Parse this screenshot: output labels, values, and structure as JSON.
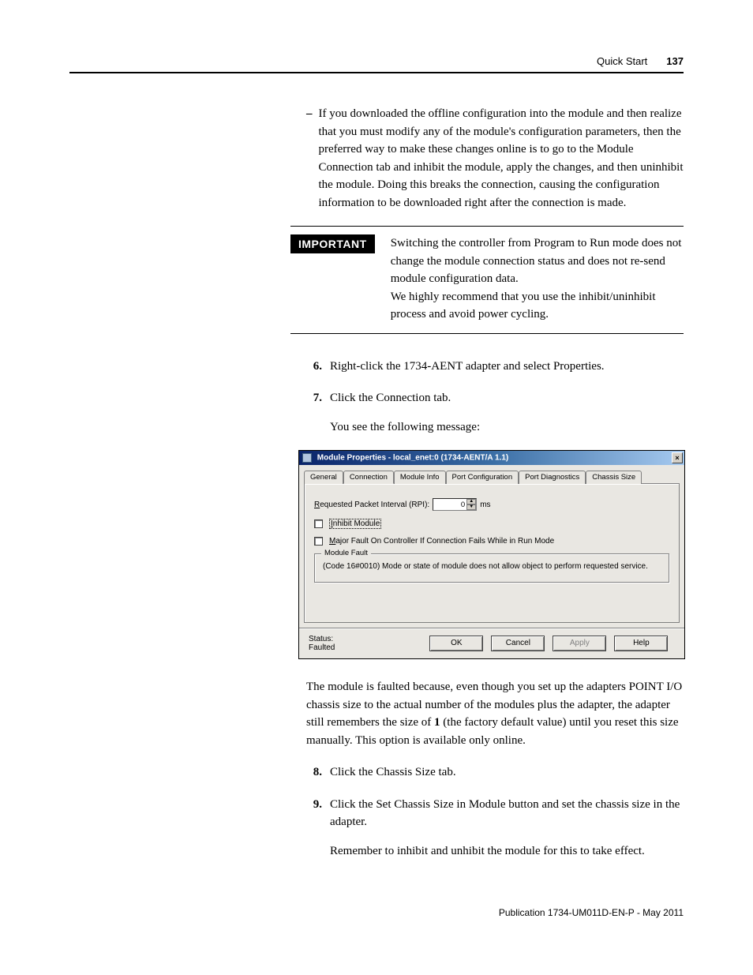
{
  "header": {
    "section": "Quick Start",
    "page": "137"
  },
  "body": {
    "bullet_text": "If you downloaded the offline configuration into the module and then realize that you must modify any of the module's configuration parameters, then the preferred way to make these changes online is to go to the Module Connection tab and inhibit the module, apply the changes, and then uninhibit the module. Doing this breaks the connection, causing the configuration information to be downloaded right after the connection is made.",
    "important_label": "IMPORTANT",
    "important_p1": "Switching the controller from Program to Run mode does not change the module connection status and does not re-send module configuration data.",
    "important_p2": "We highly recommend that you use the inhibit/uninhibit process and avoid power cycling.",
    "steps": {
      "s6_num": "6.",
      "s6": "Right-click the 1734-AENT adapter and select Properties.",
      "s7_num": "7.",
      "s7": "Click the Connection tab.",
      "s7_after": "You see the following message:",
      "after_dialog": "The module is faulted because, even though you set up the adapters POINT I/O chassis size to the actual number of the modules plus the adapter, the adapter still remembers the size of ",
      "after_dialog_bold": "1",
      "after_dialog2": " (the factory default value) until you reset this size manually. This option is available only online.",
      "s8_num": "8.",
      "s8": "Click the Chassis Size tab.",
      "s9_num": "9.",
      "s9": "Click the Set Chassis Size in Module button and set the chassis size in the adapter.",
      "s9_after": "Remember to inhibit and unhibit the module for this to take effect."
    }
  },
  "dialog": {
    "title": "Module Properties - local_enet:0 (1734-AENT/A 1.1)",
    "close": "×",
    "tabs": {
      "general": "General",
      "connection": "Connection",
      "module_info": "Module Info",
      "port_config": "Port Configuration",
      "port_diag": "Port Diagnostics",
      "chassis": "Chassis Size"
    },
    "rpi_label_pre": "R",
    "rpi_label_rest": "equested Packet Interval (RPI):",
    "rpi_value": "0",
    "rpi_unit": "ms",
    "inhibit_pre": "I",
    "inhibit_rest": "nhibit Module",
    "major_pre": "M",
    "major_rest": "ajor Fault On Controller If Connection Fails While in Run Mode",
    "fault_legend": "Module Fault",
    "fault_text": "(Code 16#0010) Mode or state of module does not allow object to perform requested service.",
    "status": "Status: Faulted",
    "buttons": {
      "ok": "OK",
      "cancel": "Cancel",
      "apply": "Apply",
      "help": "Help"
    }
  },
  "footer": {
    "pub": "Publication 1734-UM011D-EN-P - May 2011"
  }
}
